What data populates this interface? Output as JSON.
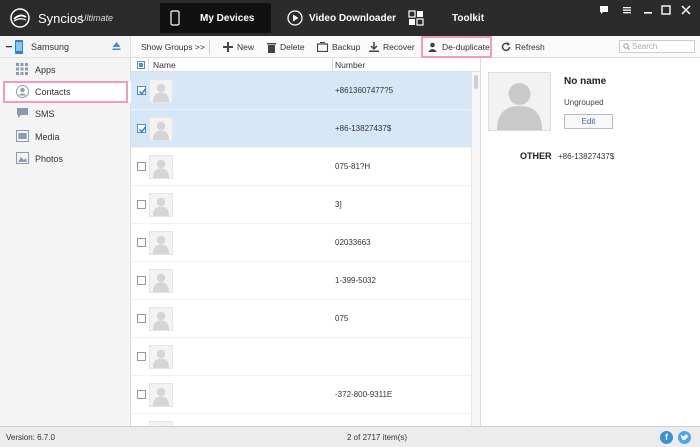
{
  "app": {
    "name": "Syncios",
    "edition": "Ultimate"
  },
  "nav": {
    "tabs": [
      {
        "label": "My Devices",
        "icon": "phone-icon",
        "active": true
      },
      {
        "label": "Video Downloader",
        "icon": "play-icon",
        "active": false
      },
      {
        "label": "Toolkit",
        "icon": "grid-icon",
        "active": false
      }
    ]
  },
  "window_controls": [
    "chat-icon",
    "menu-icon",
    "minimize-icon",
    "maximize-icon",
    "close-icon"
  ],
  "sidebar": {
    "device": "Samsung",
    "items": [
      {
        "label": "Apps",
        "icon": "apps-icon"
      },
      {
        "label": "Contacts",
        "icon": "contacts-icon",
        "selected": true
      },
      {
        "label": "SMS",
        "icon": "sms-icon"
      },
      {
        "label": "Media",
        "icon": "media-icon"
      },
      {
        "label": "Photos",
        "icon": "photos-icon"
      }
    ]
  },
  "toolbar": {
    "show_groups": "Show Groups >>",
    "new": "New",
    "delete": "Delete",
    "backup": "Backup",
    "recover": "Recover",
    "deduplicate": "De-duplicate",
    "refresh": "Refresh",
    "search_placeholder": "Search"
  },
  "list": {
    "columns": {
      "name": "Name",
      "number": "Number"
    },
    "rows": [
      {
        "number": "+8613607477?5",
        "checked": true
      },
      {
        "number": "+86-13827437$",
        "checked": true
      },
      {
        "number": "075-81?H",
        "checked": false
      },
      {
        "number": "3]",
        "checked": false
      },
      {
        "number": "02033663",
        "checked": false
      },
      {
        "number": "1-399-5032",
        "checked": false
      },
      {
        "number": "075",
        "checked": false
      },
      {
        "number": "",
        "checked": false
      },
      {
        "number": "-372-800-9311E",
        "checked": false
      },
      {
        "number": "",
        "checked": false
      }
    ]
  },
  "detail": {
    "name": "No name",
    "group": "Ungrouped",
    "edit": "Edit",
    "phone_type": "OTHER",
    "phone_number": "+86-13827437$"
  },
  "status": {
    "version": "Version: 6.7.0",
    "count": "2 of 2717 item(s)"
  },
  "colors": {
    "titlebar": "#2b2b2b",
    "selection": "#d6e7f7",
    "highlight": "#f29bbf",
    "facebook": "#3b8fd6",
    "twitter": "#4aa8e8"
  }
}
